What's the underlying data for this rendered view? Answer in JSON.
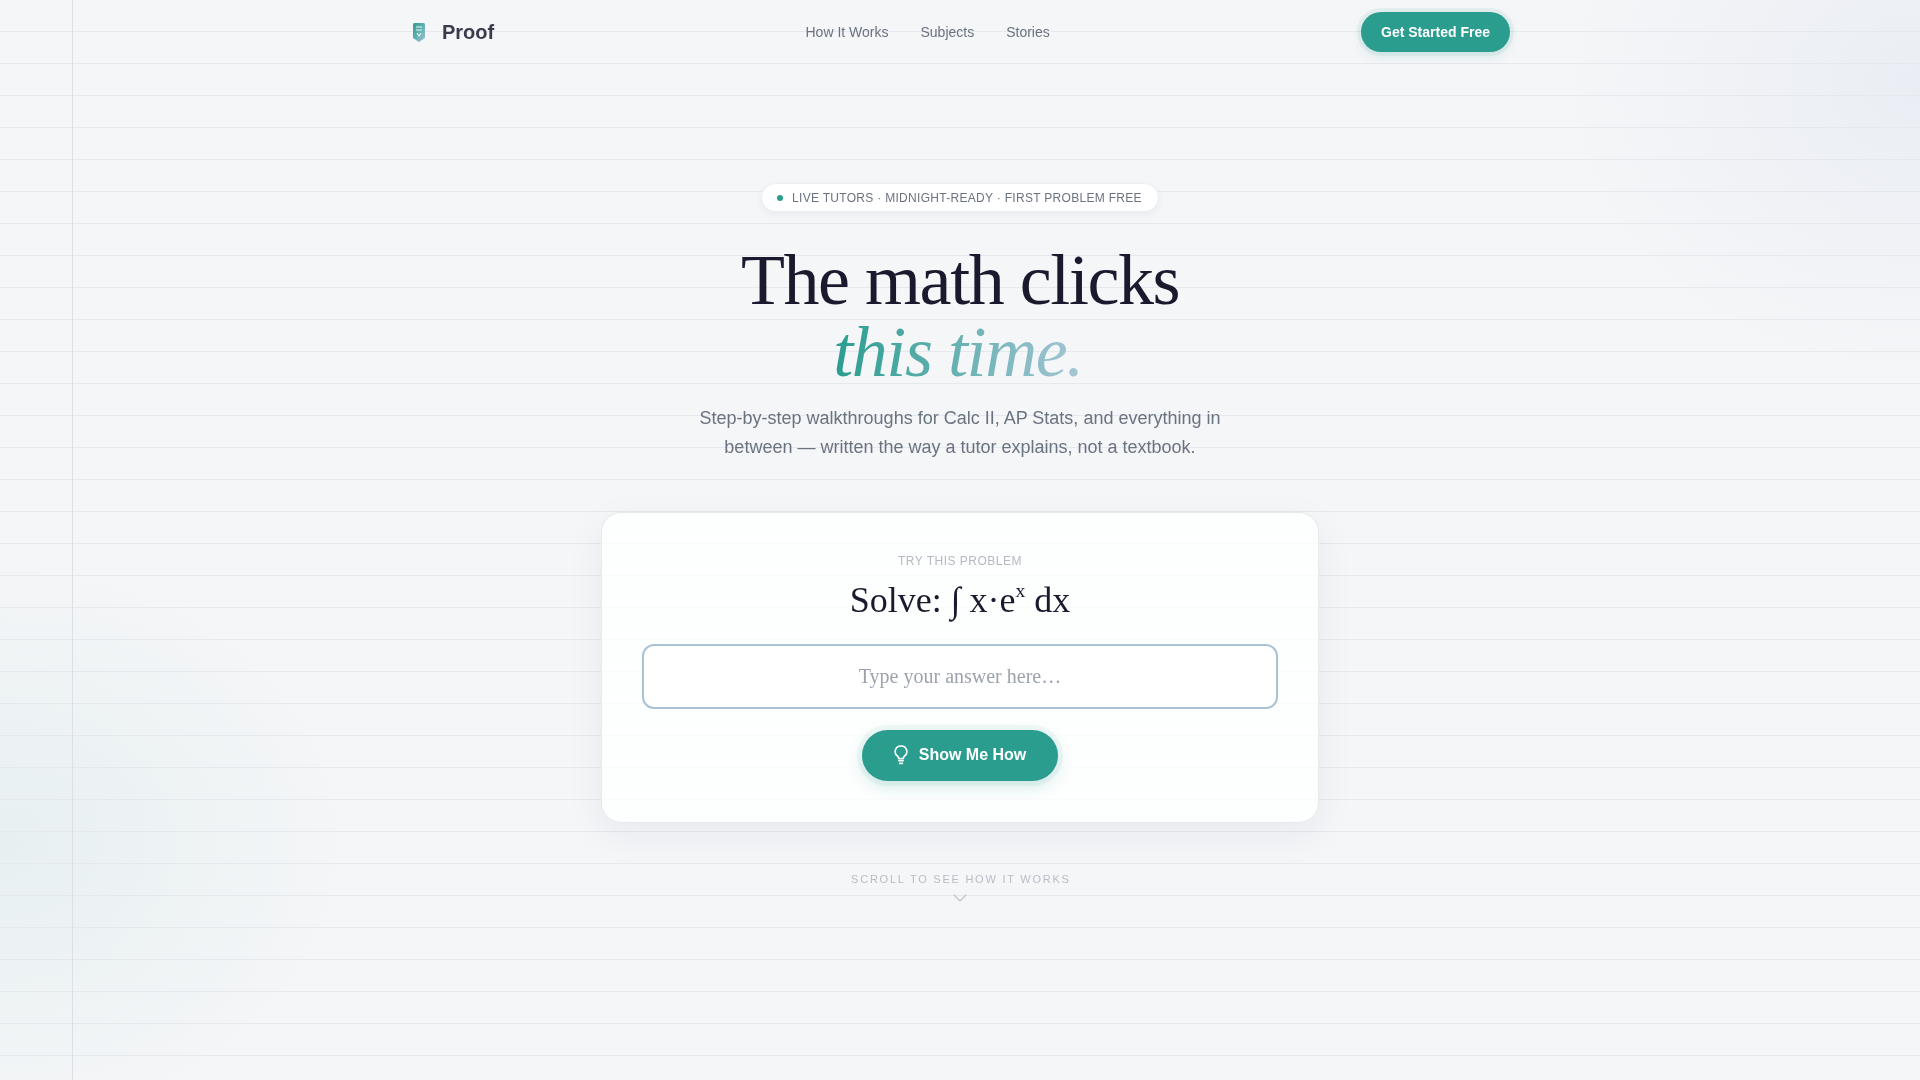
{
  "nav": {
    "logo": "Proof",
    "links": [
      "How It Works",
      "Subjects",
      "Stories"
    ],
    "cta": "Get Started Free"
  },
  "hero": {
    "badge": "LIVE TUTORS · MIDNIGHT-READY · FIRST PROBLEM FREE",
    "title": "The math clicks",
    "title_accent": "this time.",
    "subtitle": "Step-by-step walkthroughs for Calc II, AP Stats, and everything in between — written the way a tutor explains, not a textbook."
  },
  "problem_card": {
    "eyebrow": "TRY THIS PROBLEM",
    "problem": "Solve: ∫ x·e$^{x}$ dx",
    "answer": {
      "placeholder": "Type your answer here…"
    },
    "button": "Show Me How"
  },
  "scroll_hint": "SCROLL TO SEE HOW IT WORKS"
}
